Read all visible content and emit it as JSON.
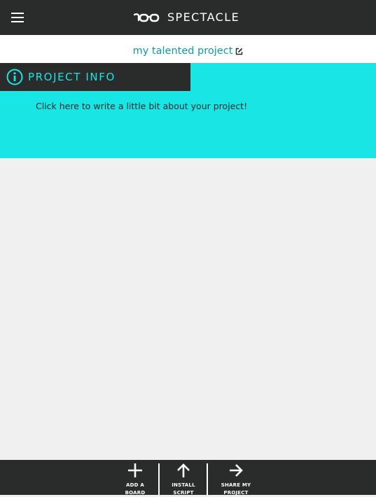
{
  "header": {
    "brand_name": "SPECTACLE",
    "menu_icon": "hamburger-menu-icon",
    "logo_icon": "spectacles-logo-icon"
  },
  "project": {
    "title": "my talented project",
    "edit_icon": "edit-pencil-icon"
  },
  "info_panel": {
    "header_label": "PROJECT INFO",
    "icon": "info-circle-icon",
    "placeholder": "Click here to write a little bit about your project!"
  },
  "toolbar": {
    "add_board": {
      "line1": "ADD A",
      "line2": "BOARD",
      "icon": "plus-icon"
    },
    "install_script": {
      "line1": "INSTALL",
      "line2": "SCRIPT",
      "icon": "arrow-up-icon"
    },
    "share_project": {
      "line1": "SHARE MY",
      "line2": "PROJECT",
      "icon": "arrow-right-icon"
    }
  },
  "colors": {
    "dark_bar": "#2a2c2c",
    "accent_cyan": "#19e5e5",
    "title_teal": "#0e9aa0",
    "workspace": "#f0f0f0"
  }
}
